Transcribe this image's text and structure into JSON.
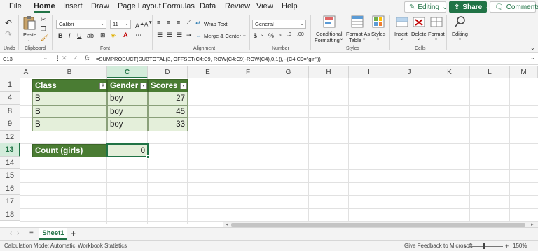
{
  "menu": {
    "items": [
      "File",
      "Home",
      "Insert",
      "Draw",
      "Page Layout",
      "Formulas",
      "Data",
      "Review",
      "View",
      "Help"
    ],
    "active": "Home",
    "editing_label": "Editing",
    "share_label": "Share",
    "comments_label": "Comments"
  },
  "ribbon": {
    "undo_label": "Undo",
    "paste_label": "Paste",
    "clipboard_label": "Clipboard",
    "font_name": "Calibri",
    "font_size": "11",
    "font_label": "Font",
    "wrap_text": "Wrap Text",
    "merge_center": "Merge & Center",
    "alignment_label": "Alignment",
    "number_format": "General",
    "number_label": "Number",
    "conditional_formatting_1": "Conditional",
    "conditional_formatting_2": "Formatting",
    "format_as_table_1": "Format As",
    "format_as_table_2": "Table",
    "styles_btn": "Styles",
    "styles_label": "Styles",
    "insert_btn": "Insert",
    "delete_btn": "Delete",
    "format_btn": "Format",
    "cells_label": "Cells",
    "editing_btn": "Editing"
  },
  "formula_bar": {
    "name_box": "C13",
    "fx": "fx",
    "formula": "=SUMPRODUCT(SUBTOTAL(3, OFFSET(C4:C9, ROW(C4:C9)-ROW(C4),0,1)),--(C4:C9=\"girl\"))"
  },
  "grid": {
    "columns": [
      "A",
      "B",
      "C",
      "D",
      "E",
      "F",
      "G",
      "H",
      "I",
      "J",
      "K",
      "L",
      "M"
    ],
    "rows": [
      "1",
      "4",
      "8",
      "9",
      "12",
      "13",
      "14",
      "15",
      "16",
      "17",
      "18"
    ],
    "table_header": [
      "Class",
      "Gender",
      "Scores"
    ],
    "table_rows": [
      [
        "B",
        "boy",
        "27"
      ],
      [
        "B",
        "boy",
        "45"
      ],
      [
        "B",
        "boy",
        "33"
      ]
    ],
    "count_label": "Count (girls)",
    "count_value": "0"
  },
  "sheets": {
    "tabs": [
      "Sheet1"
    ],
    "add": "+"
  },
  "status": {
    "calc_mode": "Calculation Mode: Automatic",
    "workbook_stats": "Workbook Statistics",
    "feedback": "Give Feedback to Microsoft",
    "zoom": "150%",
    "zoom_minus": "–",
    "zoom_plus": "+"
  },
  "colors": {
    "accent": "#217346",
    "header_fill": "#4a7c33",
    "band_fill": "#e4efda"
  }
}
